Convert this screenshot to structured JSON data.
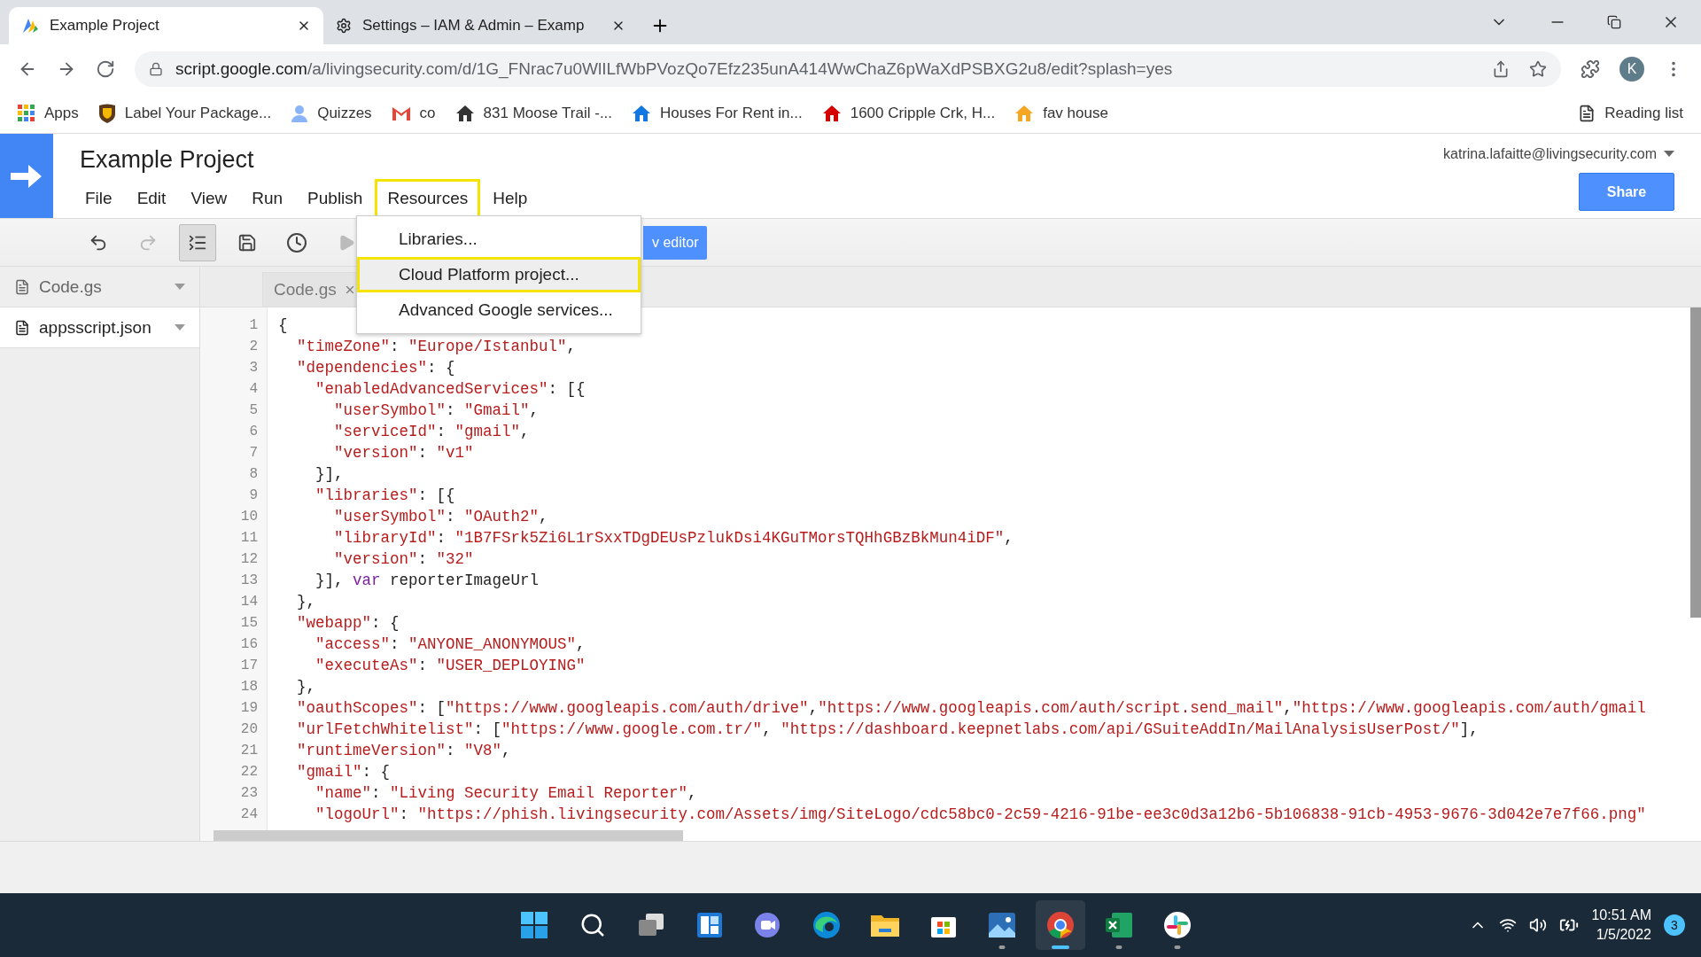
{
  "browser": {
    "tabs": [
      {
        "title": "Example Project",
        "selected": true
      },
      {
        "title": "Settings – IAM & Admin – Examp",
        "selected": false
      }
    ],
    "url_host": "script.google.com",
    "url_path": "/a/livingsecurity.com/d/1G_FNrac7u0WlILfWbPVozQo7Efz235unA414WwChaZ6pWaXdPSBXG2u8/edit?splash=yes",
    "profile_initial": "K",
    "bookmarks": [
      {
        "label": "Apps",
        "kind": "apps"
      },
      {
        "label": "Label Your Package...",
        "kind": "ups"
      },
      {
        "label": "Quizzes",
        "kind": "person"
      },
      {
        "label": "co",
        "kind": "gmail"
      },
      {
        "label": "831 Moose Trail -...",
        "kind": "house"
      },
      {
        "label": "Houses For Rent in...",
        "kind": "zillow"
      },
      {
        "label": "1600 Cripple Crk, H...",
        "kind": "redhouse"
      },
      {
        "label": "fav house",
        "kind": "orangehouse"
      }
    ],
    "reading_list": "Reading list"
  },
  "app": {
    "title": "Example Project",
    "account": "katrina.lafaitte@livingsecurity.com",
    "share": "Share",
    "menus": [
      {
        "label": "File",
        "selected": false
      },
      {
        "label": "Edit",
        "selected": false
      },
      {
        "label": "View",
        "selected": false
      },
      {
        "label": "Run",
        "selected": false
      },
      {
        "label": "Publish",
        "selected": false
      },
      {
        "label": "Resources",
        "selected": true
      },
      {
        "label": "Help",
        "selected": false
      }
    ],
    "dropdown": [
      {
        "label": "Libraries...",
        "highlighted": false
      },
      {
        "label": "Cloud Platform project...",
        "highlighted": true
      },
      {
        "label": "Advanced Google services...",
        "highlighted": false
      }
    ],
    "toolbar": [
      {
        "kind": "undo",
        "disabled": false,
        "pressed": false
      },
      {
        "kind": "redo",
        "disabled": true,
        "pressed": false
      },
      {
        "kind": "indent",
        "disabled": false,
        "pressed": true
      },
      {
        "kind": "save",
        "disabled": false,
        "pressed": false
      },
      {
        "kind": "history",
        "disabled": false,
        "pressed": false
      },
      {
        "kind": "run",
        "disabled": true,
        "pressed": false
      }
    ],
    "editor_button": "v editor",
    "files": [
      {
        "name": "Code.gs",
        "selected": false
      },
      {
        "name": "appsscript.json",
        "selected": true
      }
    ],
    "open_tab": "Code.gs",
    "code": [
      {
        "number": "1",
        "segments": [
          {
            "kind": "plain",
            "text": "{"
          }
        ]
      },
      {
        "number": "2",
        "segments": [
          {
            "kind": "str",
            "text": "  \"timeZone\""
          },
          {
            "kind": "plain",
            "text": ": "
          },
          {
            "kind": "str",
            "text": "\"Europe/Istanbul\""
          },
          {
            "kind": "plain",
            "text": ","
          }
        ]
      },
      {
        "number": "3",
        "segments": [
          {
            "kind": "str",
            "text": "  \"dependencies\""
          },
          {
            "kind": "plain",
            "text": ": {"
          }
        ]
      },
      {
        "number": "4",
        "segments": [
          {
            "kind": "str",
            "text": "    \"enabledAdvancedServices\""
          },
          {
            "kind": "plain",
            "text": ": [{"
          }
        ]
      },
      {
        "number": "5",
        "segments": [
          {
            "kind": "str",
            "text": "      \"userSymbol\""
          },
          {
            "kind": "plain",
            "text": ": "
          },
          {
            "kind": "str",
            "text": "\"Gmail\""
          },
          {
            "kind": "plain",
            "text": ","
          }
        ]
      },
      {
        "number": "6",
        "segments": [
          {
            "kind": "str",
            "text": "      \"serviceId\""
          },
          {
            "kind": "plain",
            "text": ": "
          },
          {
            "kind": "str",
            "text": "\"gmail\""
          },
          {
            "kind": "plain",
            "text": ","
          }
        ]
      },
      {
        "number": "7",
        "segments": [
          {
            "kind": "str",
            "text": "      \"version\""
          },
          {
            "kind": "plain",
            "text": ": "
          },
          {
            "kind": "str",
            "text": "\"v1\""
          }
        ]
      },
      {
        "number": "8",
        "segments": [
          {
            "kind": "plain",
            "text": "    }],"
          }
        ]
      },
      {
        "number": "9",
        "segments": [
          {
            "kind": "str",
            "text": "    \"libraries\""
          },
          {
            "kind": "plain",
            "text": ": [{"
          }
        ]
      },
      {
        "number": "10",
        "segments": [
          {
            "kind": "str",
            "text": "      \"userSymbol\""
          },
          {
            "kind": "plain",
            "text": ": "
          },
          {
            "kind": "str",
            "text": "\"OAuth2\""
          },
          {
            "kind": "plain",
            "text": ","
          }
        ]
      },
      {
        "number": "11",
        "segments": [
          {
            "kind": "str",
            "text": "      \"libraryId\""
          },
          {
            "kind": "plain",
            "text": ": "
          },
          {
            "kind": "str",
            "text": "\"1B7FSrk5Zi6L1rSxxTDgDEUsPzlukDsi4KGuTMorsTQHhGBzBkMun4iDF\""
          },
          {
            "kind": "plain",
            "text": ","
          }
        ]
      },
      {
        "number": "12",
        "segments": [
          {
            "kind": "str",
            "text": "      \"version\""
          },
          {
            "kind": "plain",
            "text": ": "
          },
          {
            "kind": "str",
            "text": "\"32\""
          }
        ]
      },
      {
        "number": "13",
        "segments": [
          {
            "kind": "plain",
            "text": "    }], "
          },
          {
            "kind": "kw",
            "text": "var"
          },
          {
            "kind": "plain",
            "text": " reporterImageUrl"
          }
        ]
      },
      {
        "number": "14",
        "segments": [
          {
            "kind": "plain",
            "text": "  },"
          }
        ]
      },
      {
        "number": "15",
        "segments": [
          {
            "kind": "str",
            "text": "  \"webapp\""
          },
          {
            "kind": "plain",
            "text": ": {"
          }
        ]
      },
      {
        "number": "16",
        "segments": [
          {
            "kind": "str",
            "text": "    \"access\""
          },
          {
            "kind": "plain",
            "text": ": "
          },
          {
            "kind": "str",
            "text": "\"ANYONE_ANONYMOUS\""
          },
          {
            "kind": "plain",
            "text": ","
          }
        ]
      },
      {
        "number": "17",
        "segments": [
          {
            "kind": "str",
            "text": "    \"executeAs\""
          },
          {
            "kind": "plain",
            "text": ": "
          },
          {
            "kind": "str",
            "text": "\"USER_DEPLOYING\""
          }
        ]
      },
      {
        "number": "18",
        "segments": [
          {
            "kind": "plain",
            "text": "  },"
          }
        ]
      },
      {
        "number": "19",
        "segments": [
          {
            "kind": "str",
            "text": "  \"oauthScopes\""
          },
          {
            "kind": "plain",
            "text": ": ["
          },
          {
            "kind": "str",
            "text": "\"https://www.googleapis.com/auth/drive\""
          },
          {
            "kind": "plain",
            "text": ","
          },
          {
            "kind": "str",
            "text": "\"https://www.googleapis.com/auth/script.send_mail\""
          },
          {
            "kind": "plain",
            "text": ","
          },
          {
            "kind": "str",
            "text": "\"https://www.googleapis.com/auth/gmail"
          }
        ]
      },
      {
        "number": "20",
        "segments": [
          {
            "kind": "str",
            "text": "  \"urlFetchWhitelist\""
          },
          {
            "kind": "plain",
            "text": ": ["
          },
          {
            "kind": "str",
            "text": "\"https://www.google.com.tr/\""
          },
          {
            "kind": "plain",
            "text": ", "
          },
          {
            "kind": "str",
            "text": "\"https://dashboard.keepnetlabs.com/api/GSuiteAddIn/MailAnalysisUserPost/\""
          },
          {
            "kind": "plain",
            "text": "],"
          }
        ]
      },
      {
        "number": "21",
        "segments": [
          {
            "kind": "str",
            "text": "  \"runtimeVersion\""
          },
          {
            "kind": "plain",
            "text": ": "
          },
          {
            "kind": "str",
            "text": "\"V8\""
          },
          {
            "kind": "plain",
            "text": ","
          }
        ]
      },
      {
        "number": "22",
        "segments": [
          {
            "kind": "str",
            "text": "  \"gmail\""
          },
          {
            "kind": "plain",
            "text": ": {"
          }
        ]
      },
      {
        "number": "23",
        "segments": [
          {
            "kind": "str",
            "text": "    \"name\""
          },
          {
            "kind": "plain",
            "text": ": "
          },
          {
            "kind": "str",
            "text": "\"Living Security Email Reporter\""
          },
          {
            "kind": "plain",
            "text": ","
          }
        ]
      },
      {
        "number": "24",
        "segments": [
          {
            "kind": "str",
            "text": "    \"logoUrl\""
          },
          {
            "kind": "plain",
            "text": ": "
          },
          {
            "kind": "str",
            "text": "\"https://phish.livingsecurity.com/Assets/img/SiteLogo/cdc58bc0-2c59-4216-91be-ee3c0d3a12b6-5b106838-91cb-4953-9676-3d042e7e7f66.png\""
          }
        ]
      }
    ]
  },
  "taskbar": {
    "apps": [
      {
        "kind": "start",
        "running": false,
        "selected": false
      },
      {
        "kind": "search",
        "running": false,
        "selected": false
      },
      {
        "kind": "taskview",
        "running": false,
        "selected": false
      },
      {
        "kind": "widgets",
        "running": false,
        "selected": false
      },
      {
        "kind": "chat",
        "running": false,
        "selected": false
      },
      {
        "kind": "edge",
        "running": false,
        "selected": false
      },
      {
        "kind": "explorer",
        "running": false,
        "selected": false
      },
      {
        "kind": "store",
        "running": false,
        "selected": false
      },
      {
        "kind": "photos",
        "running": true,
        "selected": false
      },
      {
        "kind": "chrome",
        "running": true,
        "selected": true
      },
      {
        "kind": "excel",
        "running": true,
        "selected": false
      },
      {
        "kind": "slack",
        "running": true,
        "selected": false
      }
    ],
    "time": "10:51 AM",
    "date": "1/5/2022",
    "notifications": "3"
  }
}
